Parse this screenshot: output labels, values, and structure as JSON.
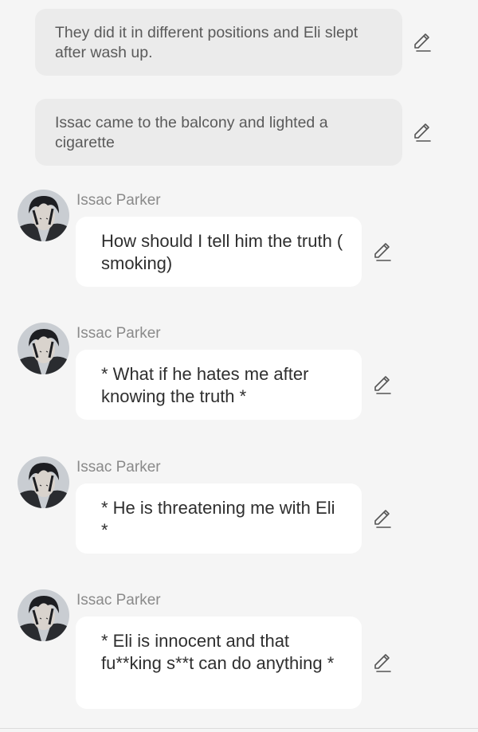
{
  "messages": [
    {
      "type": "narration",
      "text": "They did it in different positions and Eli slept after wash up."
    },
    {
      "type": "narration",
      "text": "Issac came to the balcony and lighted a cigarette"
    },
    {
      "type": "character",
      "name": "Issac Parker",
      "text": "How should I tell him the truth ( smoking)"
    },
    {
      "type": "character",
      "name": "Issac Parker",
      "text": "* What if he hates me after knowing the truth *"
    },
    {
      "type": "character",
      "name": "Issac Parker",
      "text": "* He is threatening me with Eli *"
    },
    {
      "type": "character",
      "name": "Issac Parker",
      "text": "* Eli is innocent and that fu**king s**t can do anything *"
    }
  ],
  "icons": {
    "edit": "pencil-edit-icon",
    "avatar": "character-avatar"
  },
  "colors": {
    "background": "#f5f5f5",
    "narration_bubble": "#ebebeb",
    "speech_bubble": "#ffffff",
    "name_text": "#8a8a8a",
    "body_text": "#2f2f2f"
  }
}
